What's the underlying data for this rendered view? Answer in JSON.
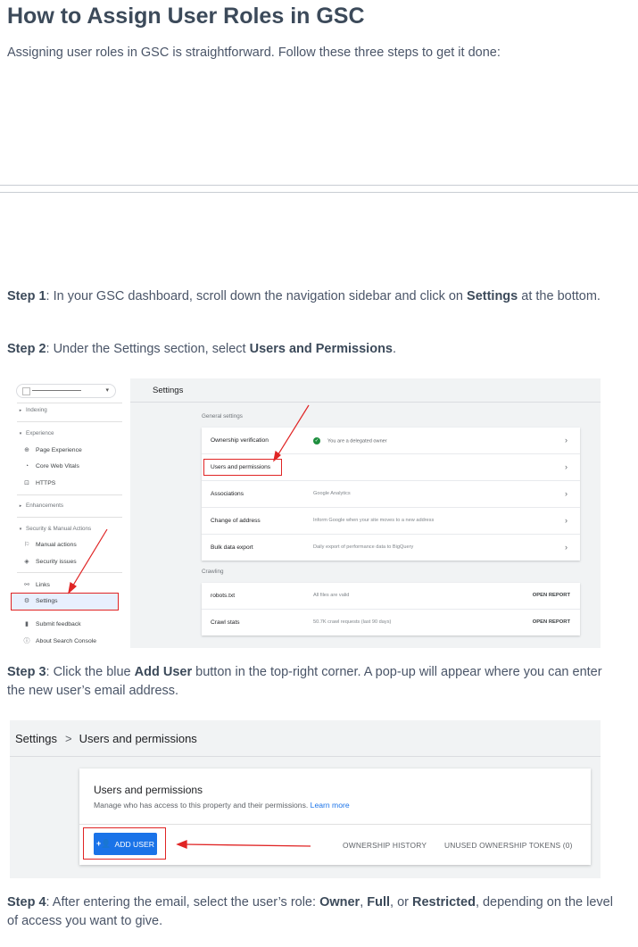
{
  "article": {
    "title": "How to Assign User Roles in GSC",
    "intro": "Assigning user roles in GSC is straightforward. Follow these three steps to get it done:",
    "step1": {
      "label": "Step 1",
      "text_a": ": In your GSC dashboard, scroll down the navigation sidebar and click on ",
      "bold": "Settings",
      "text_b": " at the bottom."
    },
    "step2": {
      "label": "Step 2",
      "text_a": ": Under the Settings section, select ",
      "bold": "Users and Permissions",
      "text_b": "."
    },
    "step3": {
      "label": "Step 3",
      "text_a": ": Click the blue ",
      "bold": "Add User",
      "text_b": " button in the top-right corner. A pop-up will appear where you can enter the new user’s email address."
    },
    "step4": {
      "label": "Step 4",
      "text_a": ": After entering the email, select the user’s role: ",
      "role1": "Owner",
      "sep1": ", ",
      "role2": "Full",
      "sep2": ", or ",
      "role3": "Restricted",
      "text_b": ", depending on the level of access you want to give."
    }
  },
  "screenshot1": {
    "sidebar": {
      "sections": [
        {
          "label": "Indexing"
        },
        {
          "label": "Experience"
        },
        {
          "label": "Enhancements"
        },
        {
          "label": "Security & Manual Actions"
        }
      ],
      "items": [
        {
          "label": "Page Experience",
          "icon": "circle-plus-icon"
        },
        {
          "label": "Core Web Vitals",
          "icon": "gauge-icon"
        },
        {
          "label": "HTTPS",
          "icon": "lock-icon"
        },
        {
          "label": "Manual actions",
          "icon": "flag-icon"
        },
        {
          "label": "Security issues",
          "icon": "shield-icon"
        },
        {
          "label": "Links",
          "icon": "links-icon"
        },
        {
          "label": "Settings",
          "icon": "gear-icon"
        },
        {
          "label": "Submit feedback",
          "icon": "feedback-icon"
        },
        {
          "label": "About Search Console",
          "icon": "info-icon"
        }
      ]
    },
    "page_title": "Settings",
    "general_heading": "General settings",
    "general_rows": [
      {
        "label": "Ownership verification",
        "value": "You are a delegated owner"
      },
      {
        "label": "Users and permissions",
        "value": ""
      },
      {
        "label": "Associations",
        "value": "Google Analytics"
      },
      {
        "label": "Change of address",
        "value": "Inform Google when your site moves to a new address"
      },
      {
        "label": "Bulk data export",
        "value": "Daily export of performance data to BigQuery"
      }
    ],
    "crawling_heading": "Crawling",
    "crawling_rows": [
      {
        "label": "robots.txt",
        "value": "All files are valid",
        "action": "OPEN REPORT"
      },
      {
        "label": "Crawl stats",
        "value": "50.7K crawl requests (last 90 days)",
        "action": "OPEN REPORT"
      }
    ],
    "highlight_color": "#e02424"
  },
  "screenshot2": {
    "breadcrumb": {
      "root": "Settings",
      "separator": ">",
      "current": "Users and permissions"
    },
    "card_title": "Users and permissions",
    "card_subtitle": "Manage who has access to this property and their permissions.",
    "learn_more": "Learn more",
    "add_user_label": "ADD USER",
    "ownership_history_label": "OWNERSHIP HISTORY",
    "unused_tokens_label": "UNUSED OWNERSHIP TOKENS (0)",
    "button_color": "#1a73e8"
  }
}
